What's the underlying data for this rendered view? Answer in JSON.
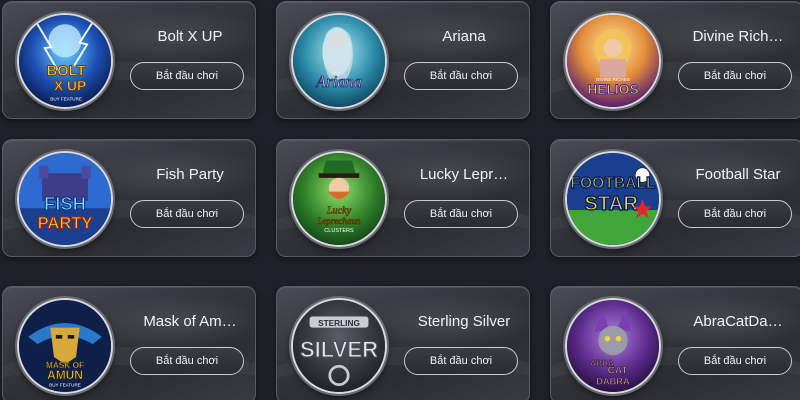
{
  "play_label": "Bắt đầu chơi",
  "games": [
    {
      "title": "Bolt X UP",
      "art_text": [
        "BOLT",
        "X UP",
        "BUY FEATURE"
      ],
      "icon": "bolt-x-up-icon",
      "colors": [
        "#0b2a6b",
        "#3fb6ff",
        "#f4d13a"
      ]
    },
    {
      "title": "Ariana",
      "art_text": [
        "Ariana"
      ],
      "icon": "ariana-mermaid-icon",
      "colors": [
        "#0e5b73",
        "#7ad6e6",
        "#e7c34a"
      ]
    },
    {
      "title": "Divine Rich…",
      "art_text": [
        "DIVINE RICHES",
        "HELIOS"
      ],
      "icon": "helios-icon",
      "colors": [
        "#7a2e8f",
        "#f0b64a",
        "#c8a24a"
      ]
    },
    {
      "title": "Fish Party",
      "art_text": [
        "FISH",
        "PARTY"
      ],
      "icon": "fish-party-icon",
      "colors": [
        "#2d6bd1",
        "#7fd2ff",
        "#f6b92d"
      ]
    },
    {
      "title": "Lucky Lepr…",
      "art_text": [
        "Lucky",
        "Leprechaun",
        "CLUSTERS"
      ],
      "icon": "lucky-leprechaun-icon",
      "colors": [
        "#1e5a24",
        "#4fbf3b",
        "#e0b33a"
      ]
    },
    {
      "title": "Football Star",
      "art_text": [
        "FOOTBALL",
        "STAR"
      ],
      "icon": "football-star-icon",
      "colors": [
        "#1b3f8f",
        "#41a63a",
        "#f3d33c"
      ]
    },
    {
      "title": "Mask of Am…",
      "art_text": [
        "MASK OF",
        "AMUN",
        "BUY FEATURE"
      ],
      "icon": "mask-of-amun-icon",
      "colors": [
        "#0e1f4a",
        "#2a78c9",
        "#e4b640"
      ]
    },
    {
      "title": "Sterling Silver",
      "art_text": [
        "STERLING",
        "SILVER"
      ],
      "icon": "sterling-silver-icon",
      "colors": [
        "#2b2d33",
        "#c9ccd3",
        "#8c9097"
      ]
    },
    {
      "title": "AbraCatDa…",
      "art_text": [
        "ABRA",
        "CAT",
        "DABRA"
      ],
      "icon": "abracatdabra-icon",
      "colors": [
        "#3b1c5e",
        "#9a62d1",
        "#e7c34a"
      ]
    }
  ]
}
